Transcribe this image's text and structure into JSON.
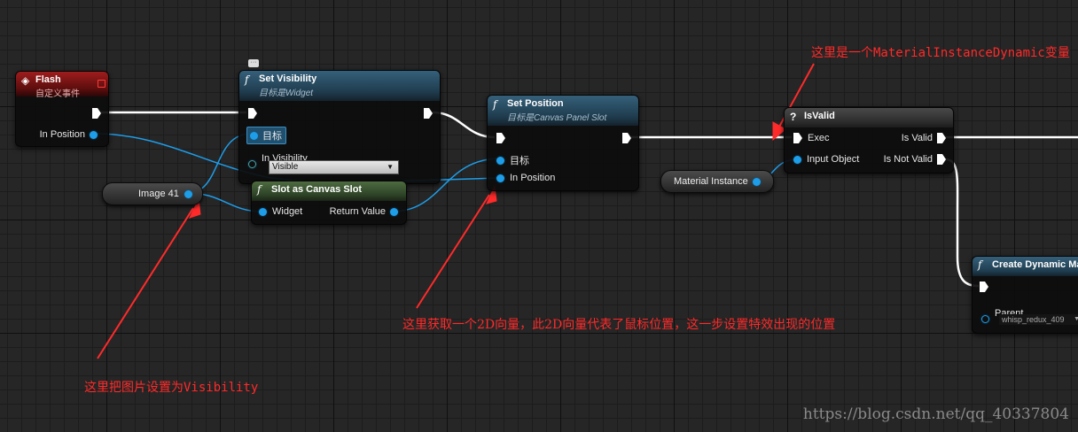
{
  "nodes": {
    "flash": {
      "title": "Flash",
      "subtitle": "自定义事件",
      "pin_in_position": "In Position"
    },
    "set_visibility": {
      "title": "Set Visibility",
      "subtitle": "目标是Widget",
      "pin_target": "目标",
      "pin_in_visibility": "In Visibility",
      "visibility_value": "Visible"
    },
    "slot_as_canvas": {
      "title": "Slot as Canvas Slot",
      "pin_widget": "Widget",
      "pin_return": "Return Value"
    },
    "set_position": {
      "title": "Set Position",
      "subtitle": "目标是Canvas Panel Slot",
      "pin_target": "目标",
      "pin_in_position": "In Position"
    },
    "is_valid": {
      "title": "IsValid",
      "pin_exec": "Exec",
      "pin_input_object": "Input Object",
      "pin_is_valid": "Is Valid",
      "pin_is_not_valid": "Is Not Valid"
    },
    "create_dynamic": {
      "title": "Create Dynamic Ma",
      "pin_parent": "Parent",
      "parent_value": "whisp_redux_409"
    }
  },
  "variables": {
    "image41": "Image 41",
    "material_instance": "Material Instance"
  },
  "annotations": {
    "material_var": "这里是一个MaterialInstanceDynamic变量",
    "mouse_pos": "这里获取一个2D向量，此2D向量代表了鼠标位置，这一步设置特效出现的位置",
    "visibility": "这里把图片设置为Visibility"
  },
  "watermark": "https://blog.csdn.net/qq_40337804",
  "colors": {
    "exec_wire": "#ffffff",
    "object_wire": "#1e9de8",
    "annotation": "#ff2a2a"
  }
}
